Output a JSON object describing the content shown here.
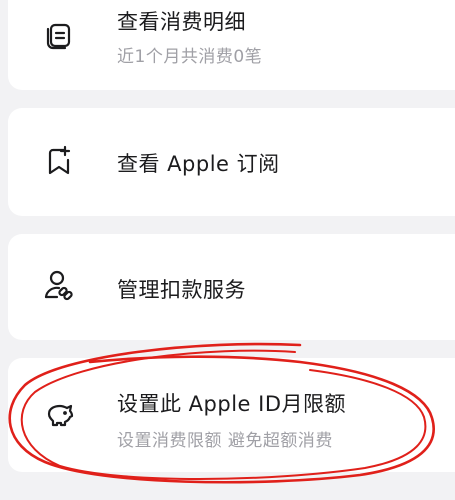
{
  "items": [
    {
      "title": "查看消费明细",
      "subtitle": "近1个月共消费0笔",
      "icon": "receipt-list-icon"
    },
    {
      "title": "查看 Apple 订阅",
      "subtitle": "",
      "icon": "bookmark-plus-icon"
    },
    {
      "title": "管理扣款服务",
      "subtitle": "",
      "icon": "user-link-icon"
    },
    {
      "title": "设置此 Apple ID月限额",
      "subtitle": "设置消费限额 避免超额消费",
      "icon": "piggy-bank-icon"
    }
  ],
  "colors": {
    "background": "#f2f2f4",
    "card": "#ffffff",
    "title": "#1c1c1e",
    "subtitle": "#a0a0a6",
    "annotation": "#e0201a"
  }
}
